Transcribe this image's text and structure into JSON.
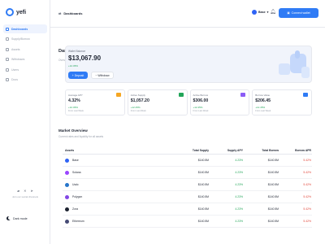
{
  "app": {
    "logo_text": "yefi"
  },
  "sidebar": {
    "items": [
      {
        "label": "Dashboards",
        "icon": "dashboard-icon",
        "active": true
      },
      {
        "label": "Supply/Borrow",
        "icon": "swap-icon",
        "active": false
      },
      {
        "label": "Assets",
        "icon": "coins-icon",
        "active": false
      },
      {
        "label": "Withdraws",
        "icon": "withdraw-icon",
        "active": false
      },
      {
        "label": "Users",
        "icon": "users-icon",
        "active": false
      },
      {
        "label": "Docs",
        "icon": "docs-icon",
        "active": false
      }
    ],
    "social_text": "Join our social channels",
    "dark_mode_label": "Dark mode"
  },
  "topbar": {
    "breadcrumb": "Dashboards",
    "network": "Base",
    "connect_label": "Connect wallet"
  },
  "header": {
    "title": "Dashboard",
    "subtitle": "Overview of your lending and borrowing activities"
  },
  "wallet": {
    "label": "Wallet Balance",
    "value": "$13,067.90",
    "change": "+12.45%",
    "deposit_label": "Deposit",
    "withdraw_label": "Withdraw"
  },
  "stats": [
    {
      "label": "Average APY",
      "value": "4.32%",
      "change": "+12.45%",
      "period": "From Last Week",
      "icon_color": "#f5a623"
    },
    {
      "label": "Active Supply",
      "value": "$1,057.20",
      "change": "+12.45%",
      "period": "From Last Week",
      "icon_color": "#22a559"
    },
    {
      "label": "Active Borrow",
      "value": "$306.00",
      "change": "+12.45%",
      "period": "From Last Week",
      "icon_color": "#8b5cf6"
    },
    {
      "label": "Borrow Value",
      "value": "$206.45",
      "change": "+12.45%",
      "period": "From Last Week",
      "icon_color": "#2f7bf5"
    }
  ],
  "market": {
    "title": "Market Overview",
    "subtitle": "Current rates and liquidity for all assets",
    "columns": [
      "Assets",
      "Total Supply",
      "Supply APY",
      "Total Borrow",
      "Borrow APR"
    ],
    "rows": [
      {
        "asset": "Base",
        "coin_color": "#2f63f5",
        "supply": "$140.5M",
        "apy": "4.23%",
        "borrow": "$140.5M",
        "apr": "5.42%"
      },
      {
        "asset": "Solana",
        "coin_color": "#9945ff",
        "supply": "$140.5M",
        "apy": "4.23%",
        "borrow": "$140.5M",
        "apr": "5.42%"
      },
      {
        "asset": "Usdc",
        "coin_color": "#2775ca",
        "supply": "$140.5M",
        "apy": "4.23%",
        "borrow": "$140.5M",
        "apr": "5.42%"
      },
      {
        "asset": "Polygon",
        "coin_color": "#8247e5",
        "supply": "$140.5M",
        "apy": "4.23%",
        "borrow": "$140.5M",
        "apr": "5.42%"
      },
      {
        "asset": "Zora",
        "coin_color": "#1c2230",
        "supply": "$140.5M",
        "apy": "4.23%",
        "borrow": "$140.5M",
        "apr": "5.42%"
      },
      {
        "asset": "Ethereum",
        "coin_color": "#454a75",
        "supply": "$140.5M",
        "apy": "4.23%",
        "borrow": "$140.5M",
        "apr": "5.42%"
      }
    ]
  }
}
